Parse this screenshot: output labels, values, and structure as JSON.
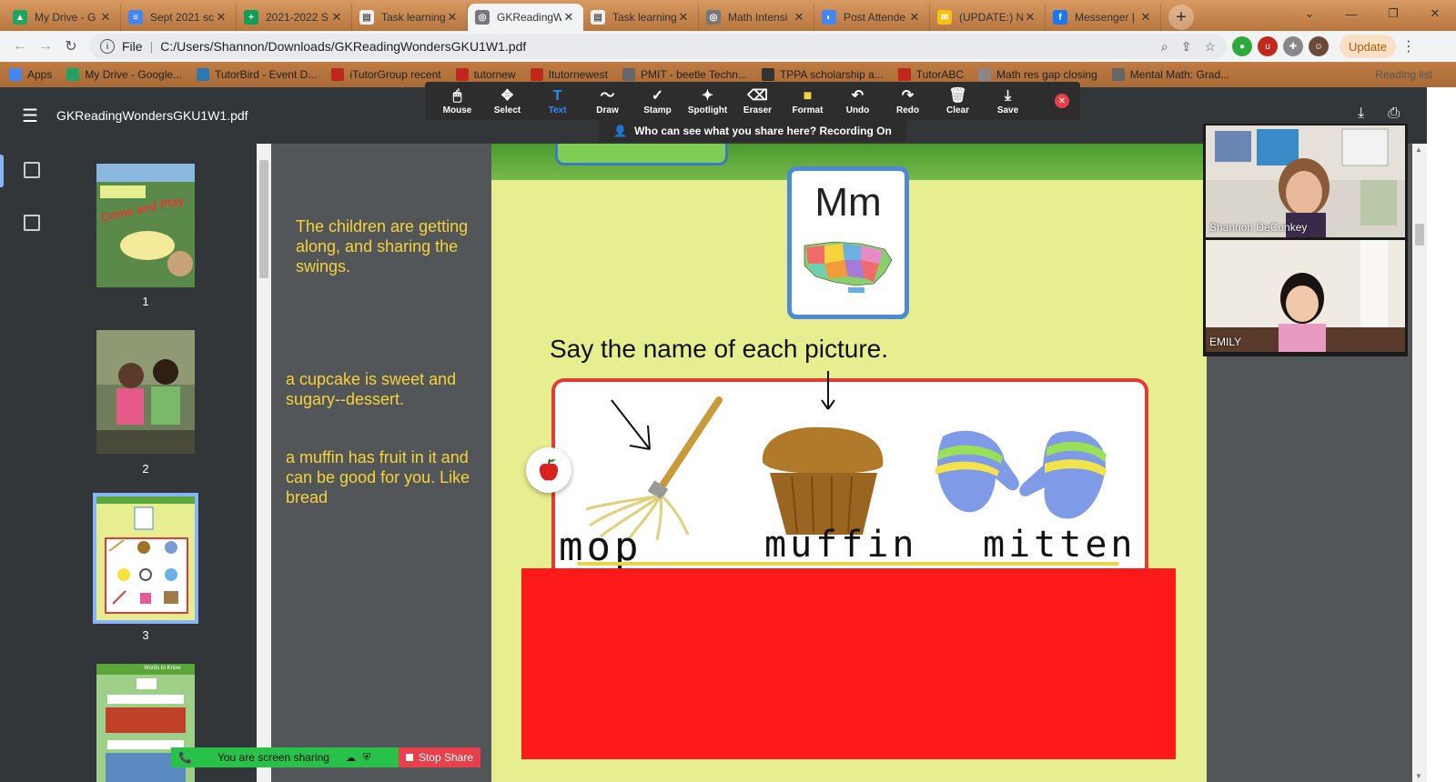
{
  "colors": {
    "accent": "#2d8cff",
    "zoom_green": "#28c14a",
    "zoom_red": "#e8404a",
    "note_yellow": "#f6d33a",
    "cover_red": "#ff1a1a"
  },
  "browser": {
    "tabs": [
      {
        "title": "My Drive - G",
        "icon": "drive-icon",
        "active": false
      },
      {
        "title": "Sept 2021 sc",
        "icon": "docs-icon",
        "active": false
      },
      {
        "title": "2021-2022 S",
        "icon": "sheets-icon",
        "active": false
      },
      {
        "title": "Task learning",
        "icon": "page-icon",
        "active": false
      },
      {
        "title": "GKReadingW",
        "icon": "globe-icon",
        "active": true
      },
      {
        "title": "Task learning",
        "icon": "page-icon",
        "active": false
      },
      {
        "title": "Math Intensi",
        "icon": "globe-icon",
        "active": false
      },
      {
        "title": "Post Attende",
        "icon": "loading-icon",
        "active": false
      },
      {
        "title": "(UPDATE:) N",
        "icon": "mail-icon",
        "active": false
      },
      {
        "title": "Messenger |",
        "icon": "facebook-icon",
        "active": false
      }
    ],
    "address": {
      "scheme": "File",
      "url": "C:/Users/Shannon/Downloads/GKReadingWondersGKU1W1.pdf"
    },
    "update_label": "Update",
    "bookmarks": [
      "Apps",
      "My Drive - Google...",
      "TutorBird - Event D...",
      "iTutorGroup recent",
      "tutornew",
      "Itutornewest",
      "PMIT - beetle Techn...",
      "TPPA scholarship a...",
      "TutorABC",
      "Math res gap closing",
      "Mental Math: Grad..."
    ],
    "reading_list": "Reading list"
  },
  "pdf": {
    "title": "GKReadingWondersGKU1W1.pdf",
    "thumbnails": [
      {
        "num": "1",
        "cover_text": "Come and Play"
      },
      {
        "num": "2"
      },
      {
        "num": "3"
      },
      {
        "num": "4",
        "header_text": "Words to Know"
      }
    ]
  },
  "zoom": {
    "tools": [
      {
        "label": "Mouse",
        "glyph": "🖱",
        "selected": false
      },
      {
        "label": "Select",
        "glyph": "✥",
        "selected": false
      },
      {
        "label": "Text",
        "glyph": "T",
        "selected": true
      },
      {
        "label": "Draw",
        "glyph": "〜",
        "selected": false
      },
      {
        "label": "Stamp",
        "glyph": "✓",
        "selected": false
      },
      {
        "label": "Spotlight",
        "glyph": "✦",
        "selected": false
      },
      {
        "label": "Eraser",
        "glyph": "⌫",
        "selected": false
      },
      {
        "label": "Format",
        "glyph": "■",
        "selected": false
      },
      {
        "label": "Undo",
        "glyph": "↶",
        "selected": false
      },
      {
        "label": "Redo",
        "glyph": "↷",
        "selected": false
      },
      {
        "label": "Clear",
        "glyph": "🗑",
        "selected": false
      },
      {
        "label": "Save",
        "glyph": "⤓",
        "selected": false
      }
    ],
    "recording_notice": "Who can see what you share here? Recording On",
    "participants": [
      "Shannon DeConkey",
      "EMILY"
    ],
    "sharing_text": "You are screen sharing",
    "stop_share": "Stop Share"
  },
  "notes": [
    "The children are getting along, and sharing the swings.",
    "a cupcake is sweet and sugary--dessert.",
    "a muffin has fruit in it and can be good for you. Like bread"
  ],
  "worksheet": {
    "letter_card": "Mm",
    "instruction": "Say the name of each picture.",
    "words": [
      "mop",
      "muffin",
      "mitten"
    ]
  }
}
